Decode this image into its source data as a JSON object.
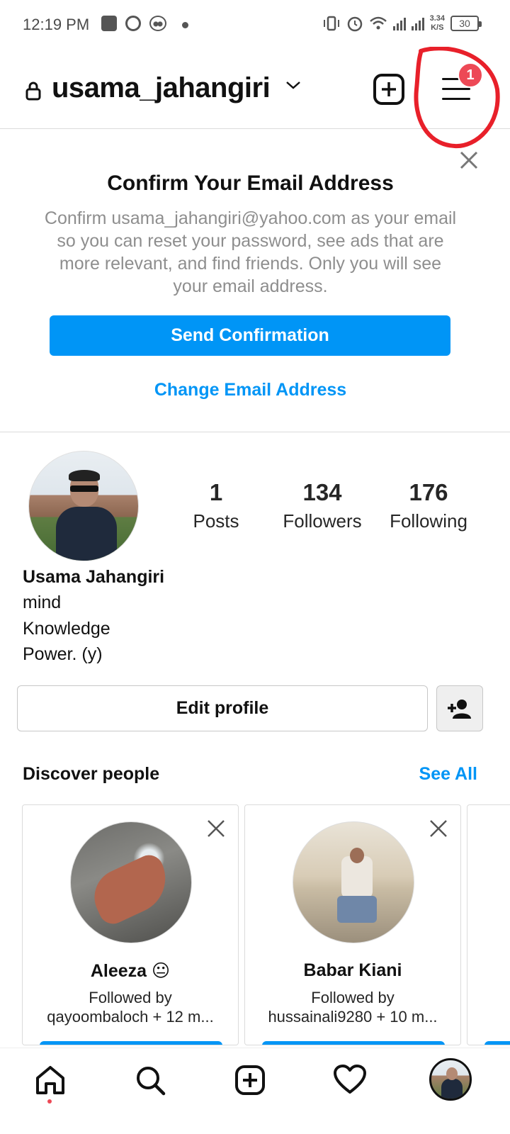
{
  "status_bar": {
    "time": "12:19 PM",
    "net_speed_value": "3.34",
    "net_speed_unit": "K/S",
    "battery": "30"
  },
  "header": {
    "username": "usama_jahangiri",
    "notification_count": "1"
  },
  "confirm_email": {
    "title": "Confirm Your Email Address",
    "body": "Confirm usama_jahangiri@yahoo.com as your email so you can reset your password, see ads that are more relevant, and find friends. Only you will see your email address.",
    "send_button": "Send Confirmation",
    "change_link": "Change Email Address"
  },
  "profile": {
    "stats": [
      {
        "value": "1",
        "label": "Posts"
      },
      {
        "value": "134",
        "label": "Followers"
      },
      {
        "value": "176",
        "label": "Following"
      }
    ],
    "full_name": "Usama Jahangiri",
    "bio": [
      "mind",
      "Knowledge",
      "Power. (y)"
    ],
    "edit_button": "Edit profile"
  },
  "discover": {
    "title": "Discover people",
    "see_all": "See All",
    "cards": [
      {
        "name": "Aleeza 😐",
        "followed_by": "Followed by",
        "mutuals": "qayoombaloch + 12 m..."
      },
      {
        "name": "Babar Kiani",
        "followed_by": "Followed by",
        "mutuals": "hussainali9280 + 10 m..."
      }
    ]
  },
  "colors": {
    "accent": "#0095f6",
    "badge": "#ed4956",
    "annotation": "#e8202a"
  },
  "icons": {
    "lock": "lock-icon",
    "chevron": "chevron-down-icon",
    "new_post": "plus-square-icon",
    "menu": "hamburger-menu-icon",
    "close": "close-icon",
    "add_person": "add-person-icon",
    "home": "home-icon",
    "search": "search-icon",
    "add": "plus-square-icon",
    "heart": "heart-icon"
  }
}
